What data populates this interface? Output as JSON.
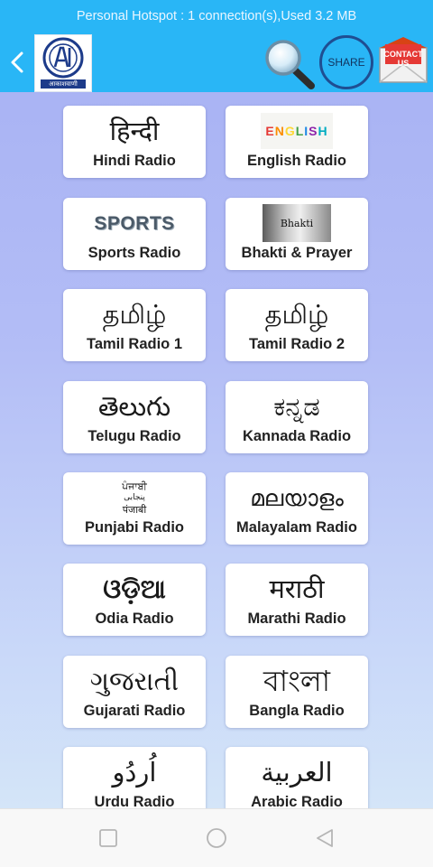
{
  "status_bar": {
    "text": "Personal Hotspot : 1 connection(s),Used  3.2 MB"
  },
  "header": {
    "logo_caption": "आकाशवाणी",
    "share_label": "SHARE",
    "contact_label": "CONTACT US"
  },
  "radios": [
    {
      "script": "हिन्दी",
      "label": "Hindi Radio"
    },
    {
      "script": "ENGLISH",
      "label": "English Radio"
    },
    {
      "script": "SPORTS",
      "label": "Sports Radio"
    },
    {
      "script": "Bhakti",
      "label": "Bhakti & Prayer"
    },
    {
      "script": "தமிழ்",
      "label": "Tamil Radio 1"
    },
    {
      "script": "தமிழ்",
      "label": "Tamil Radio 2"
    },
    {
      "script": "తెలుగు",
      "label": "Telugu Radio"
    },
    {
      "script": "ಕನ್ನಡ",
      "label": "Kannada Radio"
    },
    {
      "script": "ਪੰਜਾਬੀ",
      "script_line2": "پنجابی",
      "script_line3": "पंजाबी",
      "label": "Punjabi Radio"
    },
    {
      "script": "മലയാളം",
      "label": "Malayalam Radio"
    },
    {
      "script": "ଓଡ଼ିଆ",
      "label": "Odia Radio"
    },
    {
      "script": "मराठी",
      "label": "Marathi Radio"
    },
    {
      "script": "ગુજરાતી",
      "label": "Gujarati Radio"
    },
    {
      "script": "বাংলা",
      "label": "Bangla Radio"
    },
    {
      "script": "اُردُو",
      "label": "Urdu Radio"
    },
    {
      "script": "العربية",
      "label": "Arabic Radio"
    }
  ],
  "colors": {
    "app_bar": "#29b6f6",
    "card": "#ffffff",
    "english_letters": [
      "#e53935",
      "#fb8c00",
      "#fdd835",
      "#43a047",
      "#1e88e5",
      "#8e24aa",
      "#00acc1"
    ]
  },
  "icons": {
    "back": "chevron-left-icon",
    "search": "search-icon",
    "contact": "mail-icon",
    "nav_recent": "square-icon",
    "nav_home": "circle-icon",
    "nav_back": "triangle-back-icon"
  }
}
